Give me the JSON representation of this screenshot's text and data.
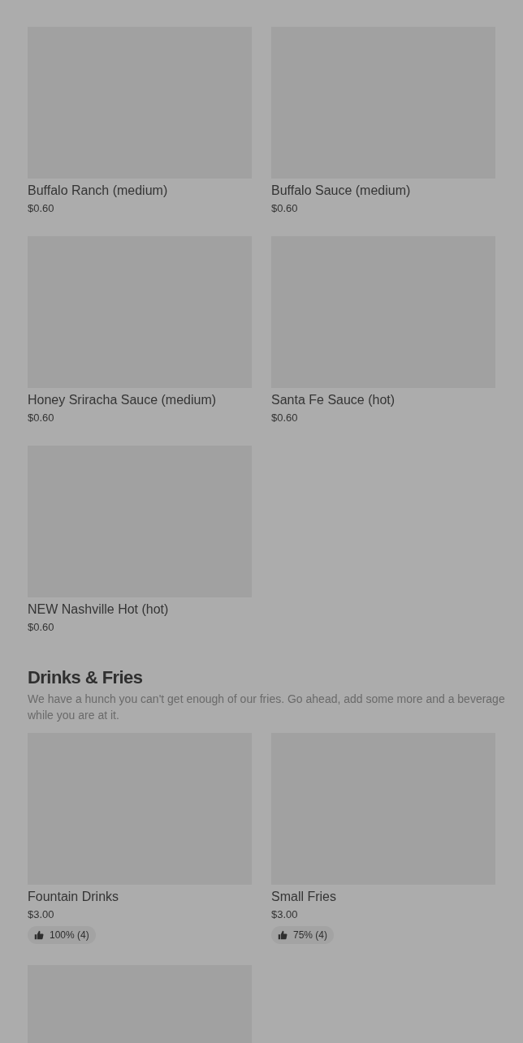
{
  "sections": [
    {
      "items": [
        {
          "kind": "item",
          "name": "Buffalo Ranch (medium)",
          "price": "$0.60"
        },
        {
          "kind": "item",
          "name": "Buffalo Sauce (medium)",
          "price": "$0.60"
        },
        {
          "kind": "item",
          "name": "Honey Sriracha Sauce (medium)",
          "price": "$0.60"
        },
        {
          "kind": "item",
          "name": "Santa Fe Sauce (hot)",
          "price": "$0.60"
        },
        {
          "kind": "item",
          "name": "NEW Nashville Hot (hot)",
          "price": "$0.60"
        }
      ]
    },
    {
      "title": "Drinks & Fries",
      "description": "We have a hunch you can't get enough of our fries. Go ahead, add some more and a beverage while you are at it.",
      "items": [
        {
          "kind": "item",
          "name": "Fountain Drinks",
          "price": "$3.00",
          "rating": "100% (4)"
        },
        {
          "kind": "item",
          "name": "Small Fries",
          "price": "$3.00",
          "rating": "75% (4)"
        },
        {
          "kind": "picture"
        }
      ]
    }
  ]
}
